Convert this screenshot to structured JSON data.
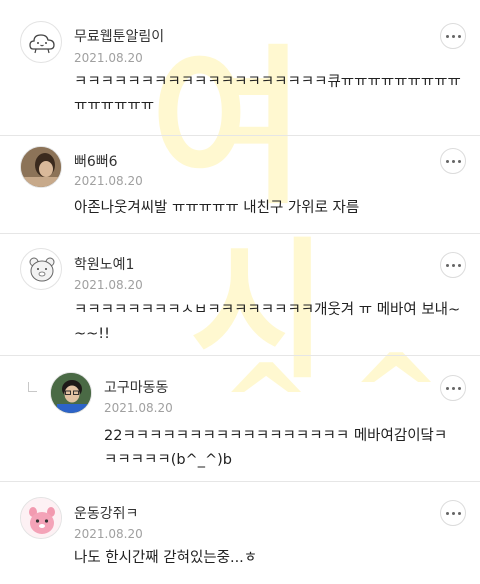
{
  "watermark": {
    "chars": [
      "여",
      "시",
      "^",
      "^"
    ]
  },
  "comments": [
    {
      "username": "무료웹툰알림이",
      "date": "2021.08.20",
      "text": "ㅋㅋㅋㅋㅋㅋㅋㅋㅋㅋㅋㅋㅋㅋㅋㅋㅋㅋㅋ큐ㅠㅠㅠㅠㅠㅠㅠㅠㅠㅠㅠㅠㅠㅠㅠ",
      "avatar": "cloud-face-icon"
    },
    {
      "username": "뻐6뻐6",
      "date": "2021.08.20",
      "text": "아존나웃겨씨발 ㅠㅠㅠㅠㅠ 내친구 가위로 자름",
      "avatar": "user-photo"
    },
    {
      "username": "학원노예1",
      "date": "2021.08.20",
      "text": "ㅋㅋㅋㅋㅋㅋㅋㅋㅅㅂㅋㅋㅋㅋㅋㅋㅋㅋ개웃겨 ㅠ 메바여 보내~~~!!",
      "avatar": "bear-icon"
    },
    {
      "username": "고구마동동",
      "date": "2021.08.20",
      "text": "22ㅋㅋㅋㅋㅋㅋㅋㅋㅋㅋㅋㅋㅋㅋㅋㅋㅋ 메바여감이닼ㅋㅋㅋㅋㅋㅋ(b^_^)b",
      "avatar": "user-photo",
      "is_reply": true
    },
    {
      "username": "운동강쥐ㅋ",
      "date": "2021.08.20",
      "text": "나도 한시간째 갇혀있는중...ㅎ",
      "avatar": "pink-character-icon"
    }
  ]
}
